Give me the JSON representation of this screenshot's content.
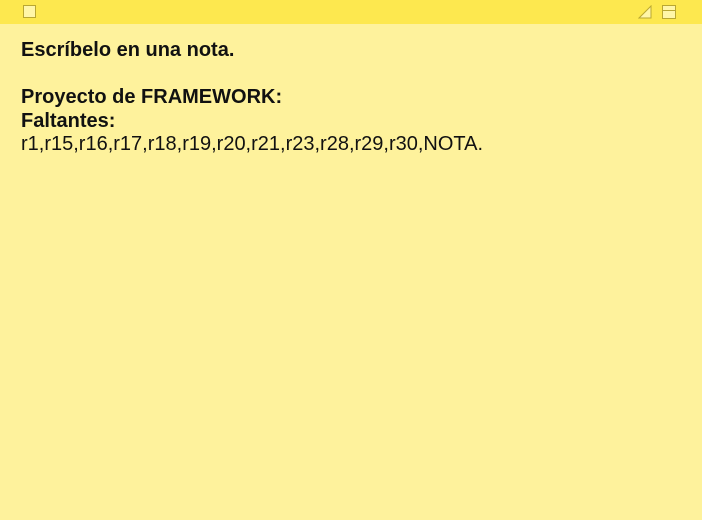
{
  "window": {
    "titlebar_color": "#fde84f",
    "background_color": "#fef29c",
    "controls": {
      "close": "close-box-icon",
      "collapse": "collapse-triangle-icon",
      "zoom": "zoom-window-icon"
    }
  },
  "note": {
    "heading": "Escríbelo en una nota.",
    "project_line": "Proyecto de FRAMEWORK:",
    "missing_label": "Faltantes:",
    "missing_items": "r1,r15,r16,r17,r18,r19,r20,r21,r23,r28,r29,r30,NOTA."
  }
}
